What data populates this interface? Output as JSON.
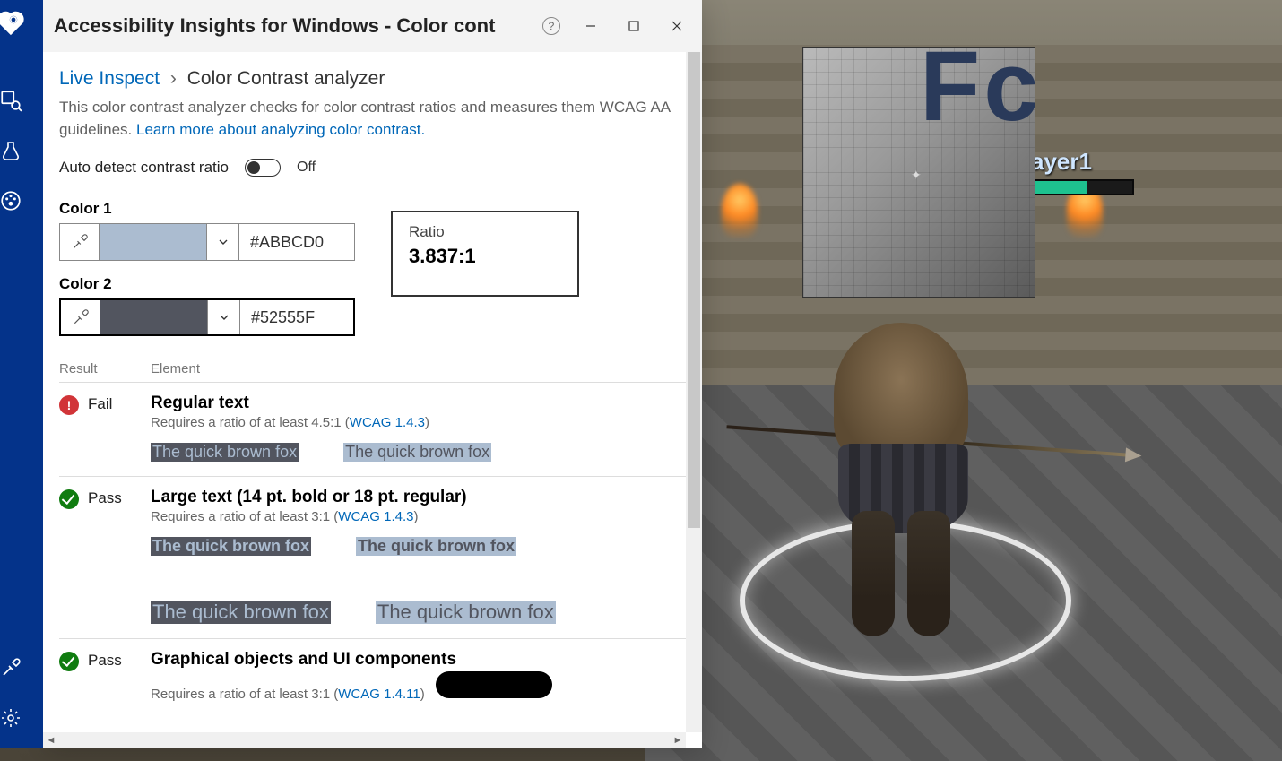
{
  "window": {
    "title": "Accessibility Insights for Windows - Color cont"
  },
  "sidebar": {
    "items": [
      {
        "name": "inspect",
        "label": "Inspect"
      },
      {
        "name": "test",
        "label": "Test"
      },
      {
        "name": "color-contrast",
        "label": "Color Contrast"
      }
    ],
    "bottom": [
      {
        "name": "eyedropper",
        "label": "Eyedropper"
      },
      {
        "name": "settings",
        "label": "Settings"
      }
    ]
  },
  "breadcrumb": {
    "root": "Live Inspect",
    "current": "Color Contrast analyzer"
  },
  "description": {
    "text": "This color contrast analyzer checks for color contrast ratios and measures them WCAG AA guidelines. ",
    "link": "Learn more about analyzing color contrast."
  },
  "autodetect": {
    "label": "Auto detect contrast ratio",
    "state": "Off"
  },
  "colors": {
    "color1": {
      "label": "Color 1",
      "hex": "#ABBCD0",
      "swatch": "#ABBCD0"
    },
    "color2": {
      "label": "Color 2",
      "hex": "#52555F",
      "swatch": "#52555F"
    }
  },
  "ratio": {
    "label": "Ratio",
    "value": "3.837:1"
  },
  "results": {
    "headers": {
      "result": "Result",
      "element": "Element"
    },
    "rows": [
      {
        "status": "Fail",
        "element": "Regular text",
        "requirement_prefix": "Requires a ratio of at least 4.5:1 (",
        "wcag": "WCAG 1.4.3",
        "requirement_suffix": ")",
        "sample": "The quick brown fox"
      },
      {
        "status": "Pass",
        "element": "Large text (14 pt. bold or 18 pt. regular)",
        "requirement_prefix": "Requires a ratio of at least 3:1 (",
        "wcag": "WCAG 1.4.3",
        "requirement_suffix": ")",
        "sample": "The quick brown fox"
      },
      {
        "status": "Pass",
        "element": "Graphical objects and UI components",
        "requirement_prefix": "Requires a ratio of at least 3:1 (",
        "wcag": "WCAG 1.4.11",
        "requirement_suffix": ")"
      }
    ]
  },
  "game": {
    "player_name": "ayer1",
    "magnifier_text": "Fc"
  }
}
